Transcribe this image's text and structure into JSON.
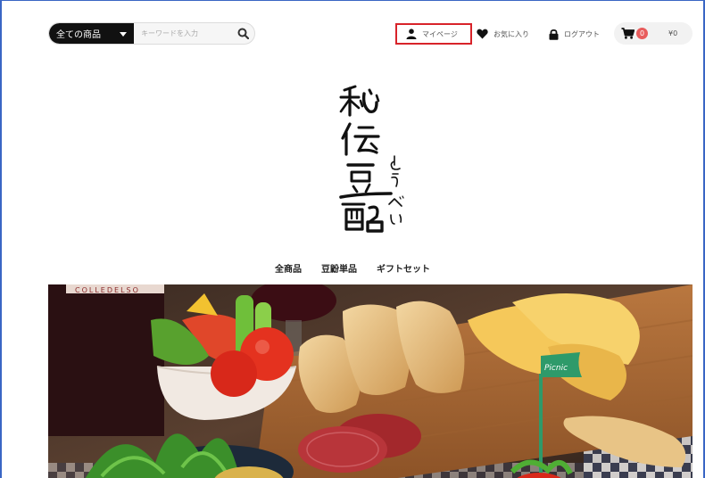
{
  "header": {
    "search": {
      "category_label": "全ての商品",
      "placeholder": "キーワードを入力"
    },
    "links": {
      "mypage": "マイページ",
      "favorite": "お気に入り",
      "logout": "ログアウト"
    },
    "cart": {
      "count": "0",
      "total": "¥0"
    }
  },
  "logo": {
    "text": [
      "秘",
      "伝",
      "豆",
      "酩"
    ],
    "ruby": [
      "と",
      "う",
      "べ",
      "い"
    ]
  },
  "gnav": {
    "items": [
      "全商品",
      "豆鼢単品",
      "ギフトセット"
    ]
  },
  "hero": {
    "bottle_label": "COLLEDELSO",
    "flag_text": "Picnic"
  },
  "colors": {
    "highlight_border": "#d8232a",
    "frame_border": "#3a66c4",
    "cart_badge": "#e85c5c"
  }
}
